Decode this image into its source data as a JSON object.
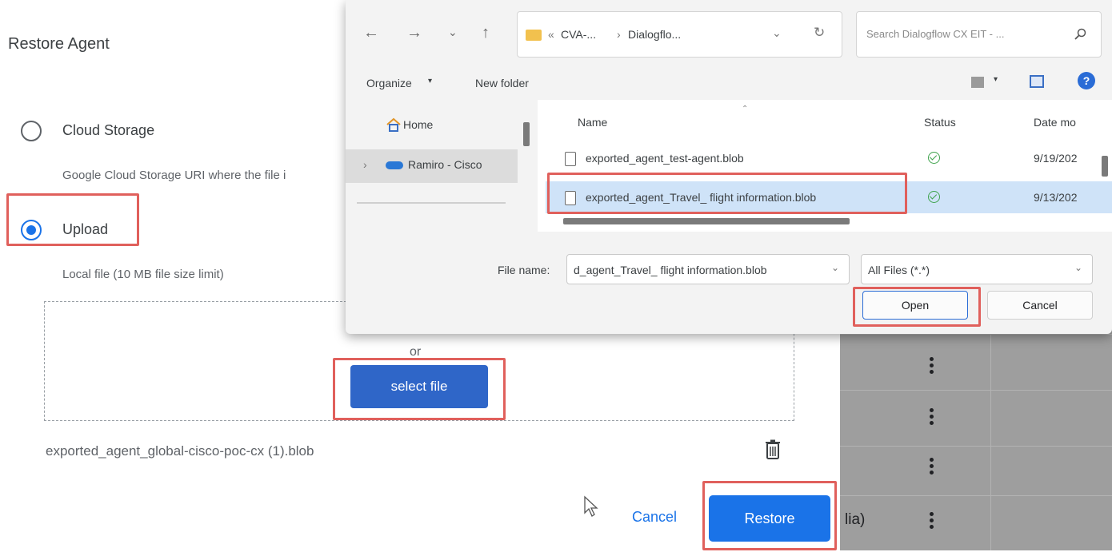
{
  "restore_panel": {
    "title": "Restore Agent",
    "options": [
      {
        "label": "Cloud Storage",
        "hint": "Google Cloud Storage URI where the file i",
        "selected": false
      },
      {
        "label": "Upload",
        "hint": "Local file (10 MB file size limit)",
        "selected": true
      }
    ],
    "drop_zone": {
      "or_text": "or",
      "select_button": "select file"
    },
    "uploaded_file": "exported_agent_global-cisco-poc-cx (1).blob",
    "cancel_label": "Cancel",
    "restore_label": "Restore",
    "accent_color": "#1a73e8"
  },
  "background_table": {
    "row_suffix": "lia)"
  },
  "file_dialog": {
    "breadcrumb": [
      "CVA-...",
      "Dialogflo..."
    ],
    "search_placeholder": "Search Dialogflow CX EIT - ...",
    "toolbar": {
      "organize": "Organize",
      "new_folder": "New folder"
    },
    "nav_items": [
      "Home",
      "Ramiro - Cisco"
    ],
    "columns": {
      "name": "Name",
      "status": "Status",
      "date": "Date mo"
    },
    "files": [
      {
        "name": "exported_agent_test-agent.blob",
        "date": "9/19/202",
        "selected": false
      },
      {
        "name": "exported_agent_Travel_ flight information.blob",
        "date": "9/13/202",
        "selected": true
      }
    ],
    "file_name_label": "File name:",
    "file_name_value": "d_agent_Travel_ flight information.blob",
    "file_type": "All Files (*.*)",
    "open_label": "Open",
    "cancel_label": "Cancel"
  }
}
